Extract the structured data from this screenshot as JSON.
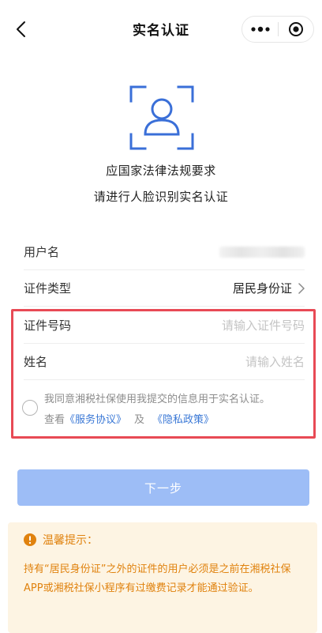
{
  "nav": {
    "title": "实名认证",
    "back_icon": "chevron-left-icon",
    "more_icon": "more-dots-icon",
    "close_icon": "target-close-icon"
  },
  "hero": {
    "icon": "face-scan-icon",
    "line1": "应国家法律法规要求",
    "line2": "请进行人脸识别实名认证",
    "accent_color": "#3a6fd8"
  },
  "form": {
    "username": {
      "label": "用户名",
      "value_obscured": true
    },
    "id_type": {
      "label": "证件类型",
      "value": "居民身份证"
    },
    "id_number": {
      "label": "证件号码",
      "placeholder": "请输入证件号码",
      "value": ""
    },
    "name": {
      "label": "姓名",
      "placeholder": "请输入姓名",
      "value": ""
    }
  },
  "agreement": {
    "checked": false,
    "text_prefix": "我同意湘税社保使用我提交的信息用于实名认证。",
    "view": "查看",
    "service_link": "《服务协议》",
    "and": "及",
    "privacy_link": "《隐私政策》"
  },
  "actions": {
    "next_label": "下一步",
    "next_enabled": false
  },
  "tip": {
    "icon": "info-icon",
    "title": "温馨提示：",
    "body": "持有“居民身份证”之外的证件的用户必须是之前在湘税社保APP或湘税社保小程序有过缴费记录才能通过验证。"
  },
  "colors": {
    "primary_disabled": "#9dbdf6",
    "link": "#3a78d6",
    "warning": "#e0820e",
    "warning_bg": "#fdf4e3",
    "highlight_border": "#e84a55"
  }
}
